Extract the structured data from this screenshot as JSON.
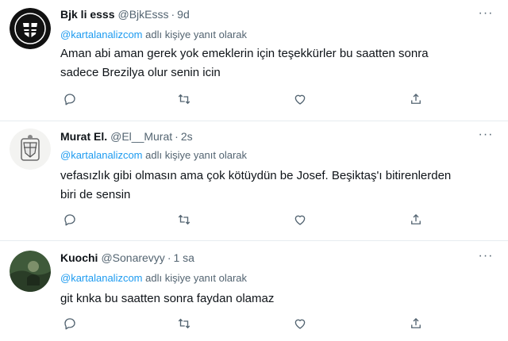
{
  "tweets": [
    {
      "name": "Bjk li esss",
      "handle": "@BjkEsss",
      "dot": "·",
      "time": "9d",
      "mention": "@kartalanalizcom",
      "reply_suffix": "adlı kişiye yanıt olarak",
      "lines": [
        "Aman abi aman gerek yok emeklerin için teşekkürler bu saatten sonra",
        "sadece Brezilya olur senin icin"
      ]
    },
    {
      "name": "Murat El.",
      "handle": "@El__Murat",
      "dot": "·",
      "time": "2s",
      "mention": "@kartalanalizcom",
      "reply_suffix": "adlı kişiye yanıt olarak",
      "lines": [
        "vefasızlık gibi olmasın ama çok kötüydün be Josef. Beşiktaş'ı bitirenlerden",
        "biri de sensin"
      ]
    },
    {
      "name": "Kuochi",
      "handle": "@Sonarevyy",
      "dot": "·",
      "time": "1 sa",
      "mention": "@kartalanalizcom",
      "reply_suffix": "adlı kişiye yanıt olarak",
      "lines": [
        "git knka bu saatten sonra faydan olamaz"
      ]
    }
  ],
  "icons": {
    "more": "more-icon",
    "reply": "reply-icon",
    "retweet": "retweet-icon",
    "like": "like-icon",
    "share": "share-icon"
  },
  "colors": {
    "text": "#0f1419",
    "secondary": "#536471",
    "mention": "#1d9bf0",
    "divider": "#e6ecf0"
  }
}
